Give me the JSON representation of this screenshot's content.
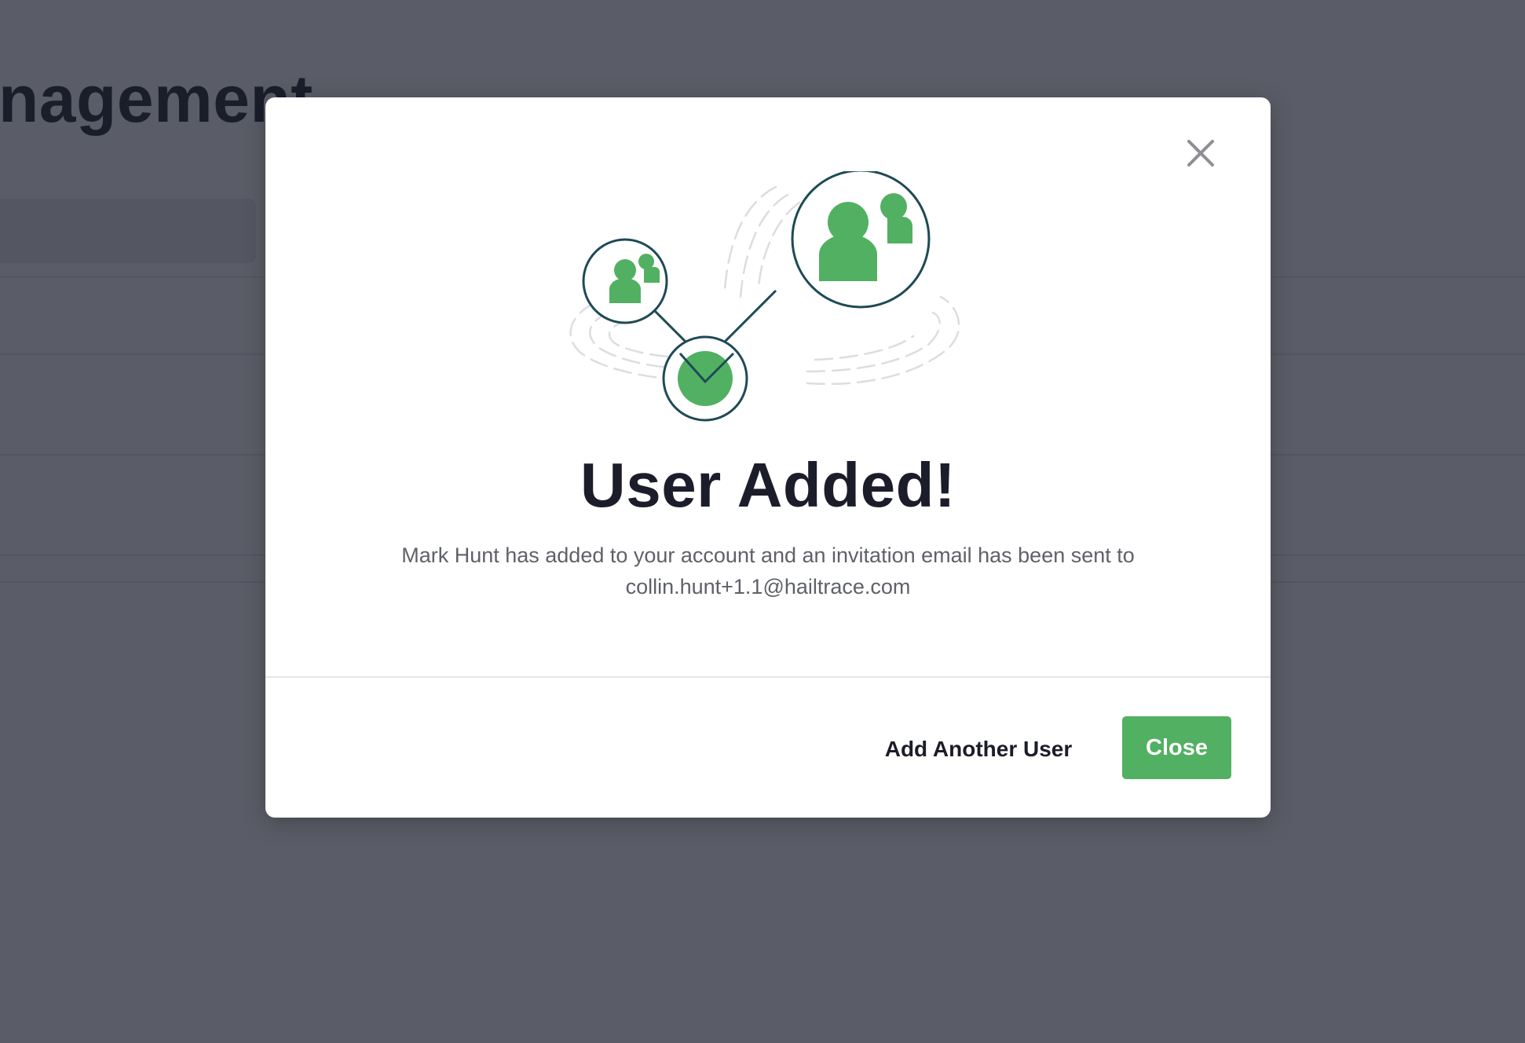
{
  "background_page": {
    "title_fragment": "nagement"
  },
  "modal": {
    "title": "User Added!",
    "message_line1": "Mark Hunt has added to your account and an invitation email has been sent to",
    "message_line2": "collin.hunt+1.1@hailtrace.com",
    "add_another_label": "Add Another User",
    "close_label": "Close",
    "close_icon": "close-icon",
    "illustration": "users-connected-illustration"
  },
  "colors": {
    "accent_green": "#52b062",
    "outline_navy": "#1e4a56",
    "overlay": "#1a1e2c",
    "title_text": "#1c1d2a",
    "body_text": "#5f6168"
  }
}
